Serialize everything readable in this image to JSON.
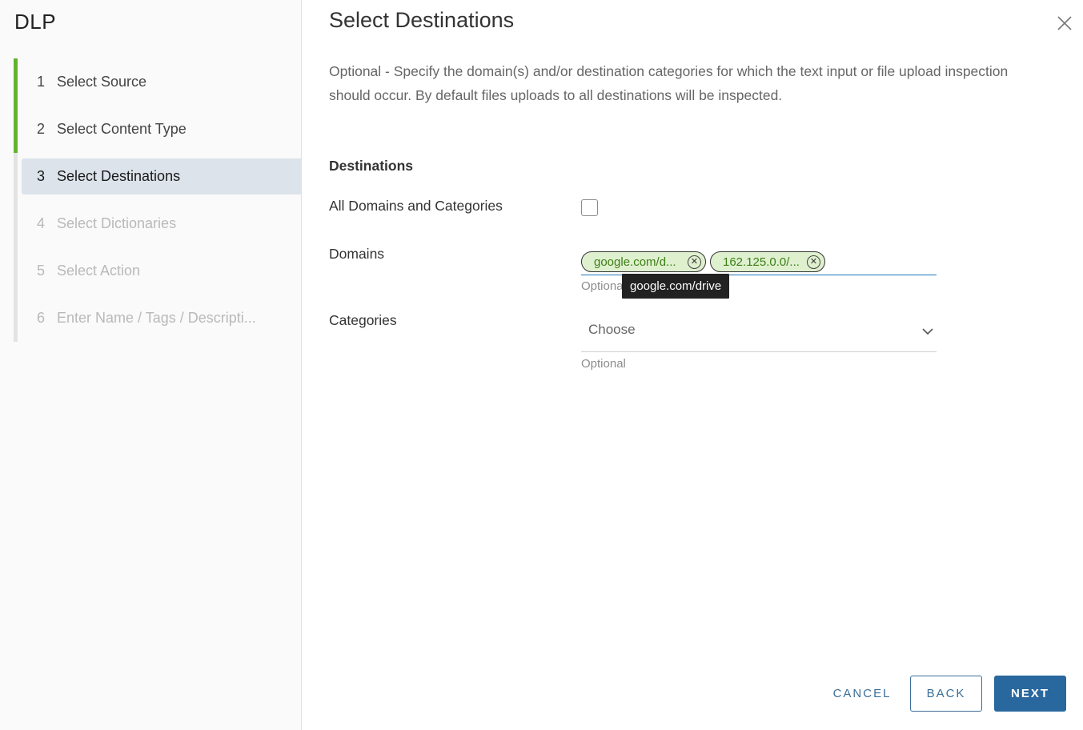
{
  "app": {
    "title": "DLP"
  },
  "wizard": {
    "steps": [
      {
        "number": "1",
        "label": "Select Source",
        "state": "done"
      },
      {
        "number": "2",
        "label": "Select Content Type",
        "state": "done"
      },
      {
        "number": "3",
        "label": "Select Destinations",
        "state": "current"
      },
      {
        "number": "4",
        "label": "Select Dictionaries",
        "state": "future"
      },
      {
        "number": "5",
        "label": "Select Action",
        "state": "future"
      },
      {
        "number": "6",
        "label": "Enter Name / Tags / Descripti...",
        "state": "future"
      }
    ]
  },
  "page": {
    "title": "Select Destinations",
    "description": "Optional - Specify the domain(s) and/or destination categories for which the text input or file upload inspection should occur. By default files uploads to all destinations will be inspected.",
    "close_icon": "close-icon"
  },
  "form": {
    "section_heading": "Destinations",
    "all_domains": {
      "label": "All Domains and Categories",
      "checked": false
    },
    "domains": {
      "label": "Domains",
      "chips": [
        {
          "display": "google.com/d...",
          "value": "google.com/drive"
        },
        {
          "display": "162.125.0.0/...",
          "value": "162.125.0.0/..."
        }
      ],
      "hint": "Optional",
      "tooltip": "google.com/drive"
    },
    "categories": {
      "label": "Categories",
      "selected": "Choose",
      "hint": "Optional"
    }
  },
  "footer": {
    "cancel_label": "CANCEL",
    "back_label": "BACK",
    "next_label": "NEXT"
  },
  "colors": {
    "accent": "#28689e",
    "step_done": "#62b32c",
    "chip_bg": "#dff0cf",
    "chip_text": "#3d7e16",
    "active_step_bg": "#dce3ea"
  }
}
